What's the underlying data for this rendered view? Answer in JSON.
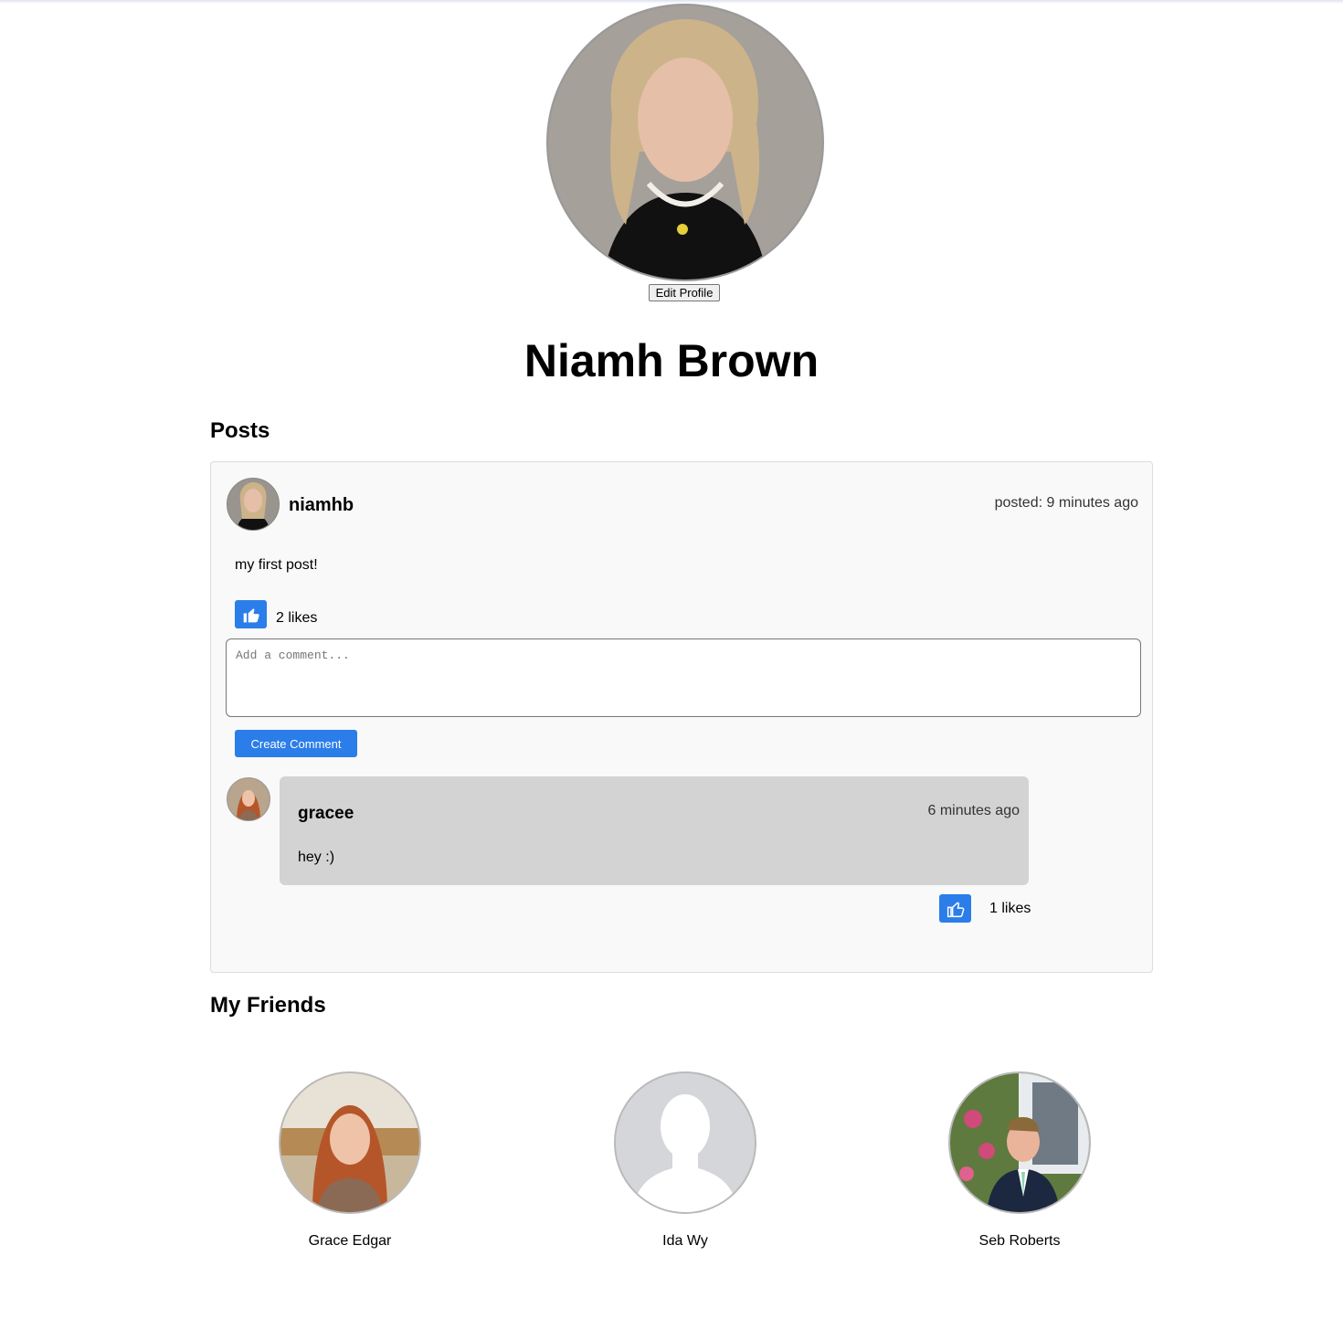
{
  "profile": {
    "name": "Niamh Brown",
    "edit_label": "Edit Profile"
  },
  "posts_section": {
    "title": "Posts"
  },
  "post": {
    "username": "niamhb",
    "time": "posted: 9 minutes ago",
    "body": "my first post!",
    "likes": "2 likes",
    "comment_placeholder": "Add a comment...",
    "create_comment_label": "Create Comment",
    "comments": [
      {
        "username": "gracee",
        "time": "6 minutes ago",
        "text": "hey :)",
        "likes": "1 likes"
      }
    ]
  },
  "friends_section": {
    "title": "My Friends",
    "friends": [
      {
        "name": "Grace Edgar"
      },
      {
        "name": "Ida Wy"
      },
      {
        "name": "Seb Roberts"
      }
    ]
  },
  "colors": {
    "accent": "#2b7de9",
    "card_bg": "#f9f9f9",
    "comment_bg": "#d3d3d3"
  }
}
